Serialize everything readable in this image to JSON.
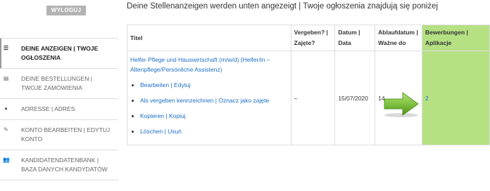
{
  "logout_label": "WYLOGUJ",
  "header_text": "Deine Stellenanzeigen werden unten angezeigt | Twoje ogłoszenia znajdują się poniżej",
  "sidebar": {
    "items": [
      {
        "icon": "list-icon",
        "label": "DEINE ANZEIGEN | TWOJE OGŁOSZENIA",
        "active": true
      },
      {
        "icon": "document-icon",
        "label": "DEINE BESTELLUNGEN | TWOJE ZAMÓWIENIA",
        "active": false
      },
      {
        "icon": "info-icon",
        "label": "ADRESSE | ADRES",
        "active": false
      },
      {
        "icon": "edit-icon",
        "label": "KONTO BEARBEITEN | EDYTUJ KONTO",
        "active": false
      },
      {
        "icon": "users-icon",
        "label": "KANDIDATENDATENBANK | BAZA DANYCH KANDYDATÓW",
        "active": false
      }
    ]
  },
  "table": {
    "headers": {
      "title": "Titel",
      "vergeben": "Vergeben? | Zajęte?",
      "datum": "Datum | Data",
      "ablauf": "Ablaufdatum | Ważne do",
      "bewerbungen": "Bewerbungen | Aplikacje"
    },
    "rows": [
      {
        "title": "Helfer Pflege und Hauswirtschaft (m/w/d) (Helfer/in – Altenpflege/Persönliche Assistenz)",
        "actions": [
          "Bearbeiten | Edytuj",
          "Als vergeben kennzeichnen | Oznacz jako zajęte",
          "Kopieren | Kopiuj",
          "Löschen | Usuń"
        ],
        "vergeben": "–",
        "datum": "15/07/2020",
        "ablauf": "14",
        "bewerbungen": "2"
      }
    ]
  },
  "colors": {
    "highlight": "#b5e183",
    "link": "#1a6fc4",
    "arrow": "#7fc241"
  }
}
